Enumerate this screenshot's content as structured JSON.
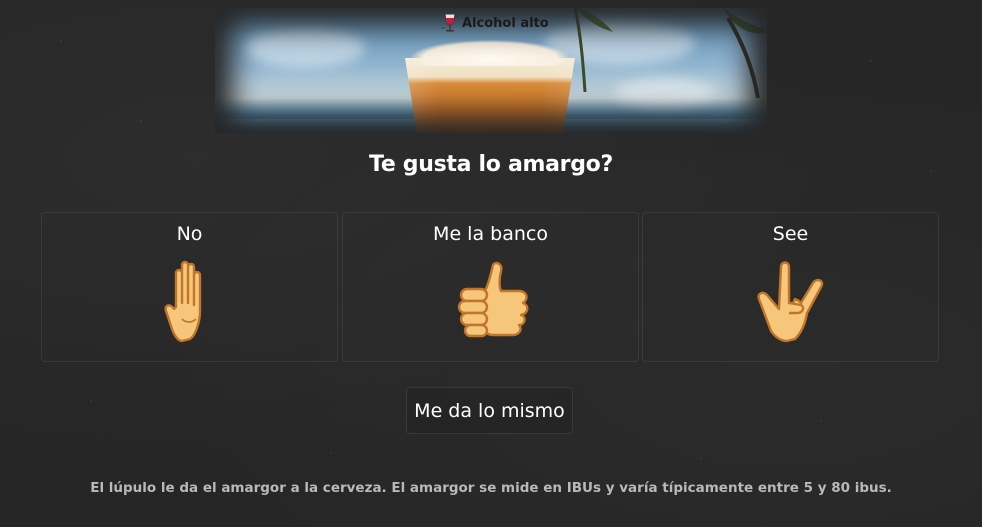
{
  "banner": {
    "tag_label": "Alcohol alto",
    "tag_icon": "wine-glass-icon"
  },
  "question": {
    "title": "Te gusta lo amargo?"
  },
  "options": [
    {
      "label": "No",
      "icon": "raised-hand-icon"
    },
    {
      "label": "Me la banco",
      "icon": "thumbs-up-icon"
    },
    {
      "label": "See",
      "icon": "rock-on-icon"
    }
  ],
  "neutral_option": {
    "label": "Me da lo mismo"
  },
  "info": {
    "text": "El lúpulo le da el amargor a la cerveza. El amargor se mide en IBUs y varía típicamente entre 5 y 80 ibus."
  },
  "colors": {
    "background": "#262626",
    "text": "#ffffff",
    "muted_text": "#b9b9b9",
    "emoji_skin": "#f6c77a",
    "emoji_outline": "#c0752b"
  }
}
